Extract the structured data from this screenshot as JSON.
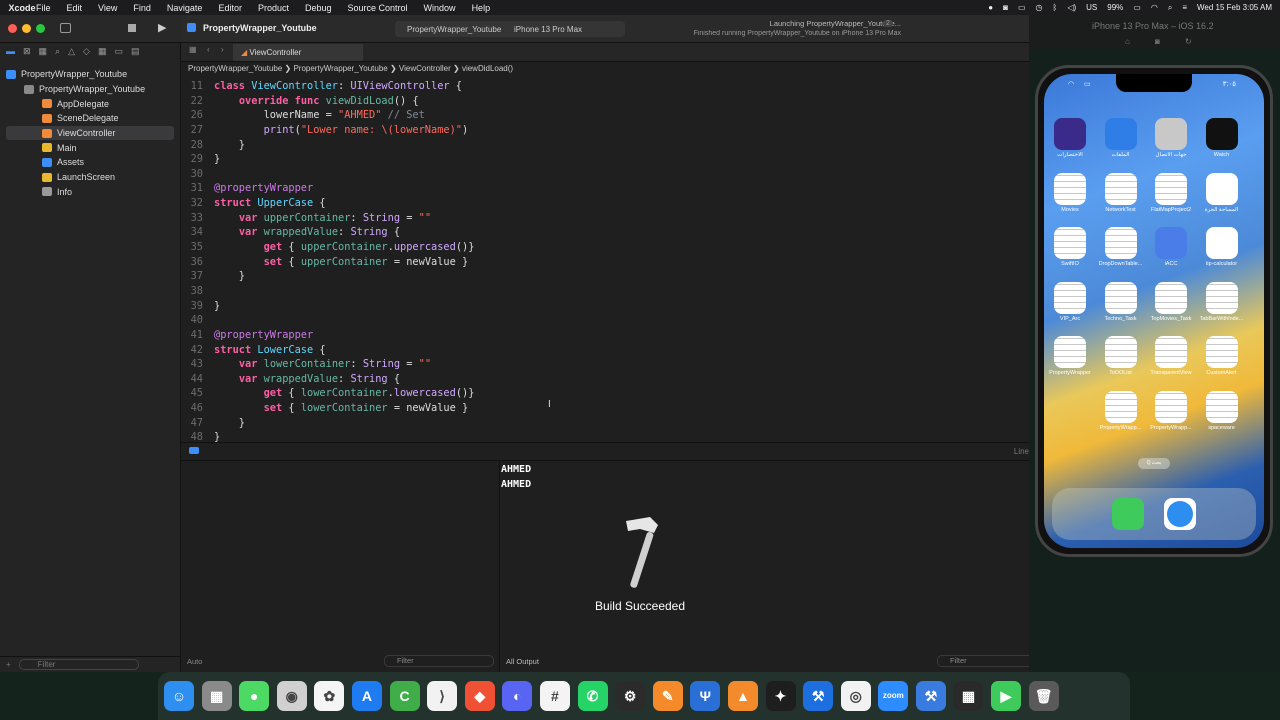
{
  "menubar": {
    "app_name": "Xcode",
    "items": [
      "File",
      "Edit",
      "View",
      "Find",
      "Navigate",
      "Editor",
      "Product",
      "Debug",
      "Source Control",
      "Window",
      "Help"
    ],
    "battery": "99%",
    "datetime": "Wed 15 Feb  3:05 AM",
    "input_source": "US"
  },
  "toolbar": {
    "project_title": "PropertyWrapper_Youtube",
    "scheme": "PropertyWrapper_Youtube",
    "destination": "iPhone 13 Pro Max",
    "status_line1": "Launching PropertyWrapper_Youtube...",
    "status_line2": "Finished running PropertyWrapper_Youtube on iPhone 13 Pro Max",
    "status_count": "2"
  },
  "navigator": {
    "items": [
      {
        "label": "PropertyWrapper_Youtube",
        "icon": "project-icon",
        "indent": 0
      },
      {
        "label": "PropertyWrapper_Youtube",
        "icon": "folder-icon",
        "indent": 1
      },
      {
        "label": "AppDelegate",
        "icon": "swift-file-icon",
        "indent": 2
      },
      {
        "label": "SceneDelegate",
        "icon": "swift-file-icon",
        "indent": 2
      },
      {
        "label": "ViewController",
        "icon": "swift-file-icon",
        "indent": 2,
        "selected": true
      },
      {
        "label": "Main",
        "icon": "storyboard-icon",
        "indent": 2
      },
      {
        "label": "Assets",
        "icon": "assets-icon",
        "indent": 2
      },
      {
        "label": "LaunchScreen",
        "icon": "storyboard-icon",
        "indent": 2
      },
      {
        "label": "Info",
        "icon": "plist-icon",
        "indent": 2
      }
    ],
    "filter_placeholder": "Filter"
  },
  "editor": {
    "tab_label": "ViewController",
    "breadcrumb": [
      "PropertyWrapper_Youtube",
      "PropertyWrapper_Youtube",
      "ViewController",
      "viewDidLoad()"
    ],
    "lines": [
      {
        "n": "11",
        "code": "class ViewController: UIViewController {"
      },
      {
        "n": "22",
        "code": "    override func viewDidLoad() {"
      },
      {
        "n": "26",
        "code": "        lowerName = \"AHMED\" // Set"
      },
      {
        "n": "27",
        "code": "        print(\"Lower name: \\(lowerName)\")"
      },
      {
        "n": "28",
        "code": "    }"
      },
      {
        "n": "29",
        "code": "}"
      },
      {
        "n": "30",
        "code": ""
      },
      {
        "n": "31",
        "code": "@propertyWrapper"
      },
      {
        "n": "32",
        "code": "struct UpperCase {"
      },
      {
        "n": "33",
        "code": "    var upperContainer: String = \"\""
      },
      {
        "n": "34",
        "code": "    var wrappedValue: String {"
      },
      {
        "n": "35",
        "code": "        get { upperContainer.uppercased()}"
      },
      {
        "n": "36",
        "code": "        set { upperContainer = newValue }"
      },
      {
        "n": "37",
        "code": "    }"
      },
      {
        "n": "38",
        "code": ""
      },
      {
        "n": "39",
        "code": "}"
      },
      {
        "n": "40",
        "code": ""
      },
      {
        "n": "41",
        "code": "@propertyWrapper"
      },
      {
        "n": "42",
        "code": "struct LowerCase {"
      },
      {
        "n": "43",
        "code": "    var lowerContainer: String = \"\""
      },
      {
        "n": "44",
        "code": "    var wrappedValue: String {"
      },
      {
        "n": "45",
        "code": "        get { lowerContainer.lowercased()}"
      },
      {
        "n": "46",
        "code": "        set { lowerContainer = newValue }"
      },
      {
        "n": "47",
        "code": "    }"
      },
      {
        "n": "48",
        "code": "}"
      }
    ],
    "line_indicator": "Line"
  },
  "debug": {
    "console_output": [
      "AHMED",
      "AHMED"
    ],
    "variables_scope": "Auto",
    "output_scope": "All Output",
    "filter_placeholder": "Filter",
    "hud_text": "Build Succeeded"
  },
  "simulator": {
    "title": "iPhone 13 Pro Max – iOS 16.2",
    "time": "٣:٠٥",
    "apps": [
      {
        "label": "الاختصارات",
        "icon": "shortcuts-icon",
        "color": "#3a2a8a"
      },
      {
        "label": "الملفات",
        "icon": "files-icon",
        "color": "#2f7ee8"
      },
      {
        "label": "جهات الاتصال",
        "icon": "contacts-icon",
        "color": "#c8c8c8"
      },
      {
        "label": "Watch",
        "icon": "watch-icon",
        "color": "#111111"
      },
      {
        "label": "Movies",
        "icon": "blank-app-icon",
        "color": ""
      },
      {
        "label": "NetworkTest",
        "icon": "blank-app-icon",
        "color": ""
      },
      {
        "label": "FlatMapProject2",
        "icon": "blank-app-icon",
        "color": ""
      },
      {
        "label": "المساحة الحرة",
        "icon": "freeform-icon",
        "color": "#ffffff"
      },
      {
        "label": "SwiftIO",
        "icon": "blank-app-icon",
        "color": ""
      },
      {
        "label": "DropDownTable...",
        "icon": "blank-app-icon",
        "color": ""
      },
      {
        "label": "iACC",
        "icon": "iacc-icon",
        "color": "#4a7de8"
      },
      {
        "label": "tip-calculator",
        "icon": "calculator-icon",
        "color": "#ffffff"
      },
      {
        "label": "VIP_Arc",
        "icon": "blank-app-icon",
        "color": ""
      },
      {
        "label": "Techno_Task",
        "icon": "blank-app-icon",
        "color": ""
      },
      {
        "label": "TopMovies_Task",
        "icon": "blank-app-icon",
        "color": ""
      },
      {
        "label": "TabBarWithInde...",
        "icon": "blank-app-icon",
        "color": ""
      },
      {
        "label": "PropertyWrapper",
        "icon": "blank-app-icon",
        "color": ""
      },
      {
        "label": "ToDOList",
        "icon": "blank-app-icon",
        "color": ""
      },
      {
        "label": "TransparentView",
        "icon": "blank-app-icon",
        "color": ""
      },
      {
        "label": "CustomAlert",
        "icon": "blank-app-icon",
        "color": ""
      },
      {
        "label": "",
        "icon": "empty-slot",
        "color": ""
      },
      {
        "label": "PropertyWrapp...",
        "icon": "blank-app-icon",
        "color": ""
      },
      {
        "label": "PropertyWrapp...",
        "icon": "blank-app-icon",
        "color": ""
      },
      {
        "label": "spaceware",
        "icon": "blank-app-icon",
        "color": ""
      }
    ],
    "search_pill": "Q بحث",
    "dock_apps": [
      {
        "icon": "messages-icon",
        "color": "#3ecb5c"
      },
      {
        "icon": "safari-icon",
        "color": "#2e8ef0"
      }
    ]
  },
  "dock": {
    "apps": [
      {
        "name": "finder-icon",
        "color": "#2f8ff0",
        "glyph": "☺"
      },
      {
        "name": "launchpad-icon",
        "color": "#8a8a8a",
        "glyph": "▦"
      },
      {
        "name": "messages-icon",
        "color": "#4cd964",
        "glyph": "●"
      },
      {
        "name": "screenshot-icon",
        "color": "#d0d0d0",
        "glyph": "◉"
      },
      {
        "name": "photos-icon",
        "color": "#f5f5f5",
        "glyph": "✿"
      },
      {
        "name": "app-store-icon",
        "color": "#1f7cf0",
        "glyph": "A"
      },
      {
        "name": "sourcetree-icon",
        "color": "#3fae49",
        "glyph": "C"
      },
      {
        "name": "vscode-icon",
        "color": "#f2f2f2",
        "glyph": "⟩"
      },
      {
        "name": "git-icon",
        "color": "#f05033",
        "glyph": "◆"
      },
      {
        "name": "discord-icon",
        "color": "#5865f2",
        "glyph": "◐"
      },
      {
        "name": "slack-icon",
        "color": "#f4f4f4",
        "glyph": "#"
      },
      {
        "name": "whatsapp-icon",
        "color": "#25d366",
        "glyph": "✆"
      },
      {
        "name": "network-icon",
        "color": "#2b2b2b",
        "glyph": "⚙"
      },
      {
        "name": "sketch-icon",
        "color": "#f58a2a",
        "glyph": "✎"
      },
      {
        "name": "fork-icon",
        "color": "#2a6fd6",
        "glyph": "Ψ"
      },
      {
        "name": "sourcetree-blue-icon",
        "color": "#f38b2d",
        "glyph": "▲"
      },
      {
        "name": "figma-icon",
        "color": "#1e1e1e",
        "glyph": "✦"
      },
      {
        "name": "xcode-icon",
        "color": "#1d6fe0",
        "glyph": "⚒"
      },
      {
        "name": "chrome-icon",
        "color": "#f2f2f2",
        "glyph": "◎"
      },
      {
        "name": "zoom-icon",
        "color": "#2d8cff",
        "glyph": "zoom"
      },
      {
        "name": "simulator-icon",
        "color": "#3a7be0",
        "glyph": "⚒"
      },
      {
        "name": "calculator-icon",
        "color": "#2a2a2a",
        "glyph": "▦"
      },
      {
        "name": "facetime-icon",
        "color": "#3ecb5c",
        "glyph": "▶"
      },
      {
        "name": "trash-icon",
        "color": "#5a5a5a",
        "glyph": "🗑"
      }
    ]
  }
}
